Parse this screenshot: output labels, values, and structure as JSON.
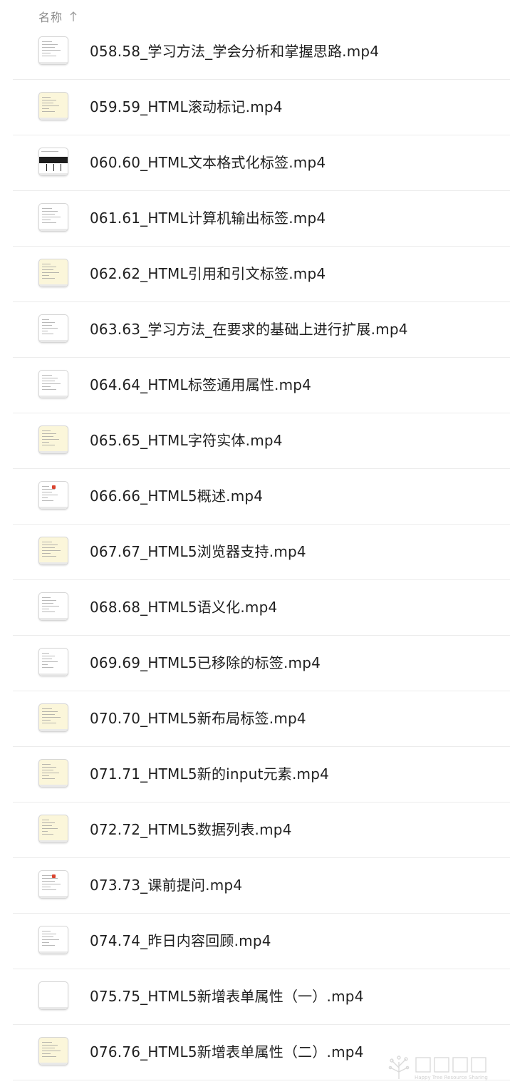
{
  "header": {
    "column_name_label": "名称",
    "sort_icon": "arrow-up-icon"
  },
  "files": [
    {
      "name": "058.58_学习方法_学会分析和掌握思路.mp4",
      "thumb": "white"
    },
    {
      "name": "059.59_HTML滚动标记.mp4",
      "thumb": "yellow"
    },
    {
      "name": "060.60_HTML文本格式化标签.mp4",
      "thumb": "dark"
    },
    {
      "name": "061.61_HTML计算机输出标签.mp4",
      "thumb": "white"
    },
    {
      "name": "062.62_HTML引用和引文标签.mp4",
      "thumb": "yellow"
    },
    {
      "name": "063.63_学习方法_在要求的基础上进行扩展.mp4",
      "thumb": "white"
    },
    {
      "name": "064.64_HTML标签通用属性.mp4",
      "thumb": "white"
    },
    {
      "name": "065.65_HTML字符实体.mp4",
      "thumb": "yellow"
    },
    {
      "name": "066.66_HTML5概述.mp4",
      "thumb": "white-red"
    },
    {
      "name": "067.67_HTML5浏览器支持.mp4",
      "thumb": "yellow"
    },
    {
      "name": "068.68_HTML5语义化.mp4",
      "thumb": "white"
    },
    {
      "name": "069.69_HTML5已移除的标签.mp4",
      "thumb": "white"
    },
    {
      "name": "070.70_HTML5新布局标签.mp4",
      "thumb": "yellow"
    },
    {
      "name": "071.71_HTML5新的input元素.mp4",
      "thumb": "yellow"
    },
    {
      "name": "072.72_HTML5数据列表.mp4",
      "thumb": "yellow"
    },
    {
      "name": "073.73_课前提问.mp4",
      "thumb": "white-red"
    },
    {
      "name": "074.74_昨日内容回顾.mp4",
      "thumb": "white"
    },
    {
      "name": "075.75_HTML5新增表单属性（一）.mp4",
      "thumb": "blank"
    },
    {
      "name": "076.76_HTML5新增表单属性（二）.mp4",
      "thumb": "yellow"
    }
  ],
  "colors": {
    "divider": "#ececec",
    "header_text": "#8a8a8a",
    "file_text": "#1f1f1f",
    "thumb_yellow": "#fbf6da"
  },
  "watermark_text": "Happy Tree Resource Sharing"
}
